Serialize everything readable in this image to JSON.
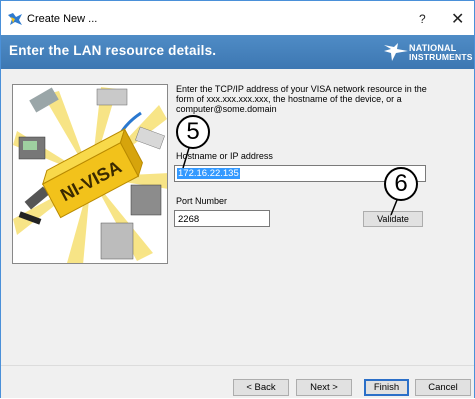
{
  "window": {
    "title": "Create New ...",
    "help_glyph": "?",
    "close_glyph": "✕"
  },
  "header": {
    "title": "Enter the LAN resource details.",
    "logo_line1": "NATIONAL",
    "logo_line2": "INSTRUMENTS"
  },
  "illustration": {
    "label": "NI-VISA"
  },
  "form": {
    "instructions": "Enter the TCP/IP address of your VISA network resource in the form of xxx.xxx.xxx.xxx, the hostname of the device, or a computer@some.domain",
    "host_label": "Hostname or IP address",
    "host_value": "172.16.22.135",
    "port_label": "Port Number",
    "port_value": "2268",
    "validate_label": "Validate"
  },
  "callouts": {
    "step5": "5",
    "step6": "6"
  },
  "footer": {
    "back_label": "< Back",
    "next_label": "Next >",
    "finish_label": "Finish",
    "cancel_label": "Cancel"
  },
  "colors": {
    "header_band": "#4a86c2",
    "selection": "#3399ff",
    "illustration_yellow": "#f2c21b"
  }
}
